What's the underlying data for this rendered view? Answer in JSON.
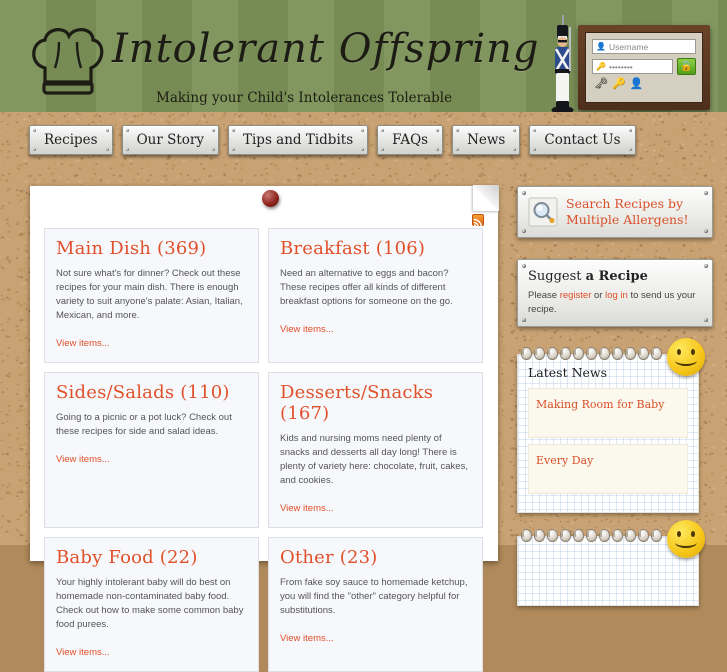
{
  "site": {
    "title": "Intolerant Offspring",
    "tagline": "Making your Child's Intolerances Tolerable",
    "logo_icon": "chef-hat-icon",
    "mascot_icon": "toy-soldier-icon"
  },
  "colors": {
    "header_green": "#7b9157",
    "wood_brown": "#6d4a2c",
    "cork_tan": "#c9a273",
    "accent_orange": "#e0502a",
    "panel_white": "#ffffff",
    "card_bg": "#f7f8fb"
  },
  "nav": {
    "items": [
      {
        "label": "Recipes"
      },
      {
        "label": "Our Story"
      },
      {
        "label": "Tips and Tidbits"
      },
      {
        "label": "FAQs"
      },
      {
        "label": "News"
      },
      {
        "label": "Contact Us"
      }
    ]
  },
  "login": {
    "username_placeholder": "Username",
    "password_value": "••••••••",
    "user_icon": "user-icon",
    "key_icon": "key-icon",
    "lock_icon": "lock-icon",
    "helper_icons": [
      {
        "name": "forgot-password-icon",
        "glyph": "🗝"
      },
      {
        "name": "forgot-username-icon",
        "glyph": "🔑"
      },
      {
        "name": "register-user-icon",
        "glyph": "👤"
      }
    ]
  },
  "main": {
    "feed_icon": "rss-icon",
    "pushpin_icon": "pushpin-icon",
    "view_label": "View items...",
    "cards": [
      {
        "title": "Main Dish (369)",
        "body": "Not sure what's for dinner?  Check out these recipes for your main dish.  There is enough variety to suit anyone's palate: Asian, Italian, Mexican, and more.",
        "link": "View items..."
      },
      {
        "title": "Breakfast (106)",
        "body": "Need an alternative to eggs and bacon?  These recipes offer all kinds of different breakfast options for someone on the go.",
        "link": "View items..."
      },
      {
        "title": "Sides/Salads (110)",
        "body": "Going to a picnic or a pot luck?  Check out these recipes for side and salad ideas.",
        "link": "View items..."
      },
      {
        "title": "Desserts/Snacks (167)",
        "body": "Kids and nursing moms need plenty of snacks and desserts all day long!  There is plenty of variety here: chocolate, fruit, cakes, and cookies.",
        "link": "View items..."
      },
      {
        "title": "Baby Food (22)",
        "body": "Your highly intolerant baby will do best on homemade non-contaminated baby food.  Check out how to make some common baby food purees.",
        "link": "View items..."
      },
      {
        "title": "Other (23)",
        "body": "From fake soy sauce to homemade ketchup, you will find the \"other\" category helpful for substitutions.",
        "link": "View items..."
      }
    ]
  },
  "sidebar": {
    "search": {
      "line1": "Search Recipes by",
      "line2": "Multiple Allergens!",
      "icon": "magnifying-glass-icon"
    },
    "suggest": {
      "title_light": "Suggest ",
      "title_bold": "a Recipe",
      "text_before": "Please ",
      "register_link": "register",
      "text_mid": " or ",
      "login_link": "log in",
      "text_after": " to send us your recipe."
    },
    "news": {
      "heading": "Latest News",
      "sticker_icon": "smiley-face-icon",
      "items": [
        {
          "title": "Making Room for Baby"
        },
        {
          "title": "Every Day"
        }
      ]
    }
  }
}
